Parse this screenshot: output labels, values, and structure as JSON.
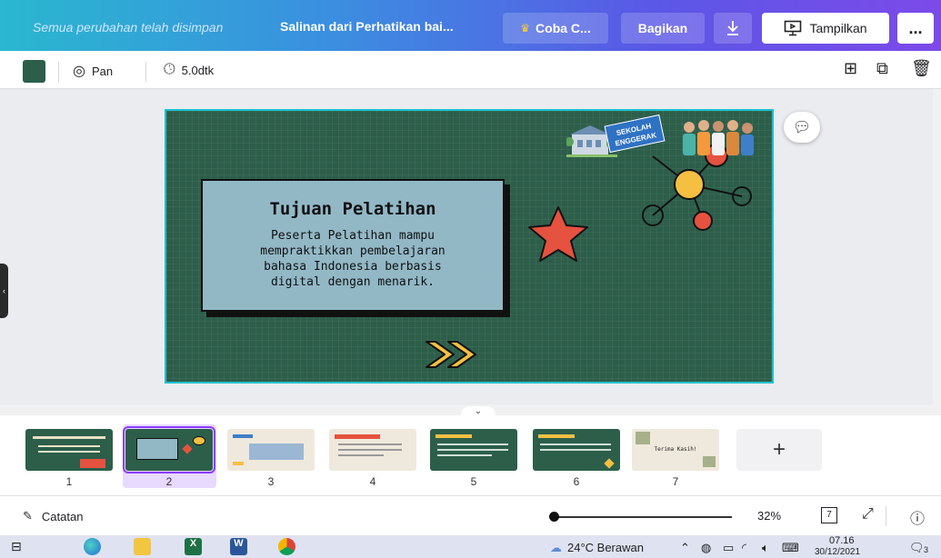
{
  "topbar": {
    "saved_status": "Semua perubahan telah disimpan",
    "doc_title": "Salinan dari Perhatikan bai...",
    "try_label": "Coba C...",
    "share_label": "Bagikan",
    "present_label": "Tampilkan",
    "more_label": "...",
    "crown_icon": "crown-icon",
    "download_icon": "download-icon"
  },
  "toolbar": {
    "color_swatch": "#2c5e4a",
    "animation_label": "Pan",
    "duration_label": "5.0dtk"
  },
  "slide": {
    "title": "Tujuan Pelatihan",
    "body_lines": [
      "Peserta Pelatihan mampu",
      "mempraktikkan pembelajaran",
      "bahasa Indonesia berbasis",
      "digital dengan menarik."
    ],
    "badge_lines": [
      "SEKOLAH",
      "ENGGERAK"
    ],
    "background": "#2c5e4a",
    "card_color": "#92b8c6"
  },
  "thumbnails": [
    {
      "num": "1",
      "bg": "#2c5e4a"
    },
    {
      "num": "2",
      "bg": "#2c5e4a"
    },
    {
      "num": "3",
      "bg": "#efe9dd"
    },
    {
      "num": "4",
      "bg": "#efe9dd"
    },
    {
      "num": "5",
      "bg": "#2c5e4a"
    },
    {
      "num": "6",
      "bg": "#2c5e4a"
    },
    {
      "num": "7",
      "bg": "#efe9dd"
    }
  ],
  "thumb7_text": "Terima Kasih!",
  "add_page_label": "+",
  "bottombar": {
    "notes_label": "Catatan",
    "zoom": "32%",
    "page_count": "7",
    "zoom_fraction": 0.02
  },
  "taskbar": {
    "weather": "24°C Berawan",
    "time": "07.16",
    "date": "30/12/2021",
    "notif_count": "3"
  }
}
